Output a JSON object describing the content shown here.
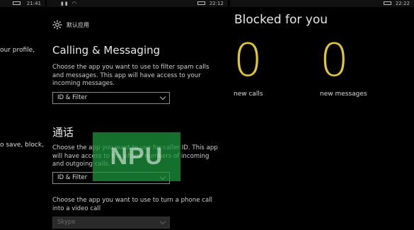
{
  "left_panel": {
    "status_time": "21:41",
    "line1": "our profile,",
    "line2": "o save, block,"
  },
  "middle_panel": {
    "status_time": "22:12",
    "app_title": "默认应用",
    "calling_section": {
      "title": "Calling & Messaging",
      "description": "Choose the app you want to use to filter spam calls and messages. This app will have access to your incoming messages.",
      "dropdown_value": "ID & Filter"
    },
    "callerid_section": {
      "title": "通话",
      "description": "Choose the app you want to use for caller ID. This app will have access to the phone numbers of incoming and outgoing calls.",
      "dropdown_value": "ID & Filter"
    },
    "video_section": {
      "description": "Choose the app you want to use to turn a phone call into a video call",
      "dropdown_value": "Skype"
    },
    "watermark": "NPU"
  },
  "right_panel": {
    "status_time": "22:22",
    "title": "Blocked for you",
    "calls_count": "0",
    "calls_label": "new calls",
    "messages_count": "0",
    "messages_label": "new messages",
    "accent_color": "#e0c829"
  }
}
